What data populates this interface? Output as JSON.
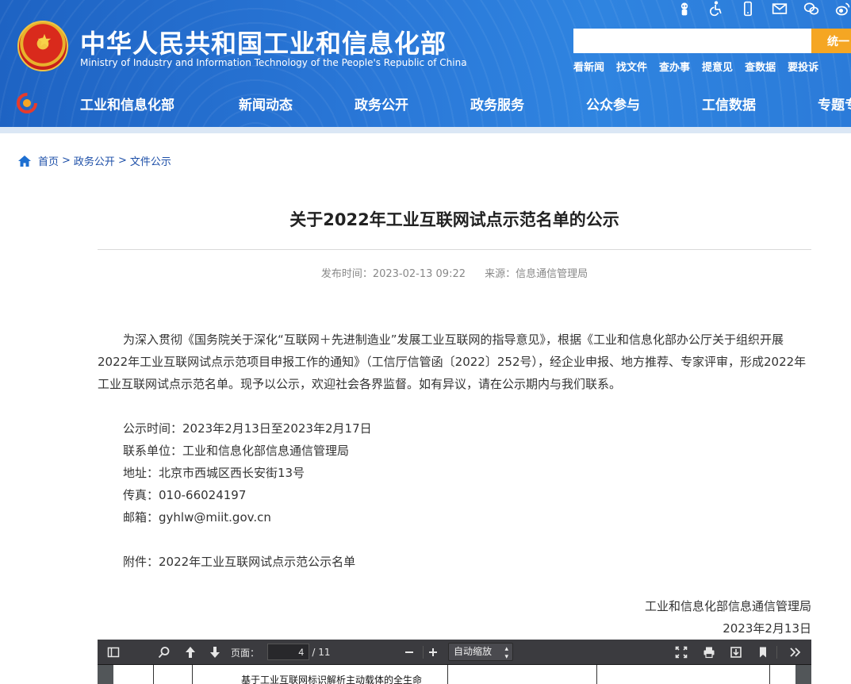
{
  "header": {
    "title_cn": "中华人民共和国工业和信息化部",
    "title_en": "Ministry of Industry and Information Technology of the People's Republic of China",
    "search_placeholder": "",
    "search_button": "统一",
    "top_icons": [
      "robot-icon",
      "accessibility-icon",
      "mobile-icon",
      "mail-icon",
      "wechat-icon",
      "weibo-icon"
    ],
    "quick_links": [
      "看新闻",
      "找文件",
      "查办事",
      "提意见",
      "查数据",
      "要投诉"
    ],
    "nav": [
      "工业和信息化部",
      "新闻动态",
      "政务公开",
      "政务服务",
      "公众参与",
      "工信数据",
      "专题专"
    ]
  },
  "breadcrumb": {
    "items": [
      "首页",
      "政务公开",
      "文件公示"
    ],
    "separator": ">"
  },
  "article": {
    "title": "关于2022年工业互联网试点示范名单的公示",
    "publish_time": "发布时间：2023-02-13 09:22",
    "source": "来源：信息通信管理局",
    "paragraph": "为深入贯彻《国务院关于深化“互联网＋先进制造业”发展工业互联网的指导意见》，根据《工业和信息化部办公厅关于组织开展2022年工业互联网试点示范项目申报工作的通知》（工信厅信管函〔2022〕252号），经企业申报、地方推荐、专家评审，形成2022年工业互联网试点示范名单。现予以公示，欢迎社会各界监督。如有异议，请在公示期内与我们联系。",
    "period": "公示时间：2023年2月13日至2023年2月17日",
    "contact_unit": "联系单位：工业和信息化部信息通信管理局",
    "address": "地址：北京市西城区西长安街13号",
    "fax": "传真：010-66024197",
    "email": "邮箱：gyhlw@miit.gov.cn",
    "attachment": "附件：2022年工业互联网试点示范公示名单",
    "signature": "工业和信息化部信息通信管理局",
    "date": "2023年2月13日"
  },
  "pdf_viewer": {
    "page_label": "页面：",
    "current_page": "4",
    "total_pages": "/ 11",
    "zoom": "自动缩放",
    "visible_cell_text": "基于工业互联网标识解析主动载体的全生命"
  },
  "colors": {
    "header_blue": "#2a78d8",
    "accent_orange": "#f5a623",
    "link_blue": "#1d4fa8",
    "toolbar_dark": "#3b3b3f"
  }
}
